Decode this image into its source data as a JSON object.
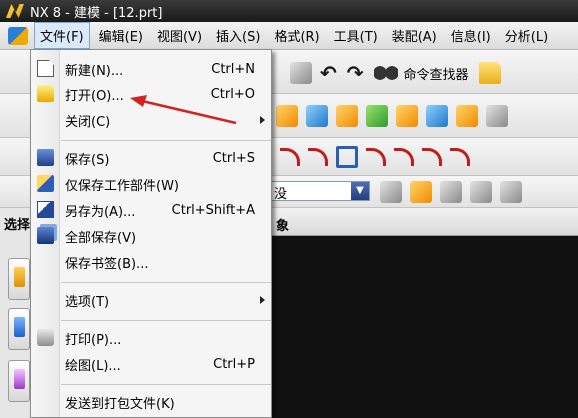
{
  "window": {
    "title": "NX 8 - 建模 - [12.prt]"
  },
  "menubar": {
    "items": [
      "文件(F)",
      "编辑(E)",
      "视图(V)",
      "插入(S)",
      "格式(R)",
      "工具(T)",
      "装配(A)",
      "信息(I)",
      "分析(L)"
    ]
  },
  "toolbar": {
    "command_finder": "命令查找器",
    "selection_combo_value": "没"
  },
  "left_panel": {
    "label": "选择"
  },
  "main": {
    "header_fragment": "象"
  },
  "file_menu": {
    "items": [
      {
        "label": "新建(N)...",
        "shortcut": "Ctrl+N"
      },
      {
        "label": "打开(O)...",
        "shortcut": "Ctrl+O"
      },
      {
        "label": "关闭(C)",
        "shortcut": ""
      },
      {
        "label": "保存(S)",
        "shortcut": "Ctrl+S"
      },
      {
        "label": "仅保存工作部件(W)",
        "shortcut": ""
      },
      {
        "label": "另存为(A)...",
        "shortcut": "Ctrl+Shift+A"
      },
      {
        "label": "全部保存(V)",
        "shortcut": ""
      },
      {
        "label": "保存书签(B)...",
        "shortcut": ""
      },
      {
        "label": "选项(T)",
        "shortcut": ""
      },
      {
        "label": "打印(P)...",
        "shortcut": ""
      },
      {
        "label": "绘图(L)...",
        "shortcut": "Ctrl+P"
      },
      {
        "label": "发送到打包文件(K)",
        "shortcut": ""
      }
    ]
  },
  "colors": {
    "annotation_arrow": "#d32222",
    "menu_highlight": "#dbe9fb"
  }
}
